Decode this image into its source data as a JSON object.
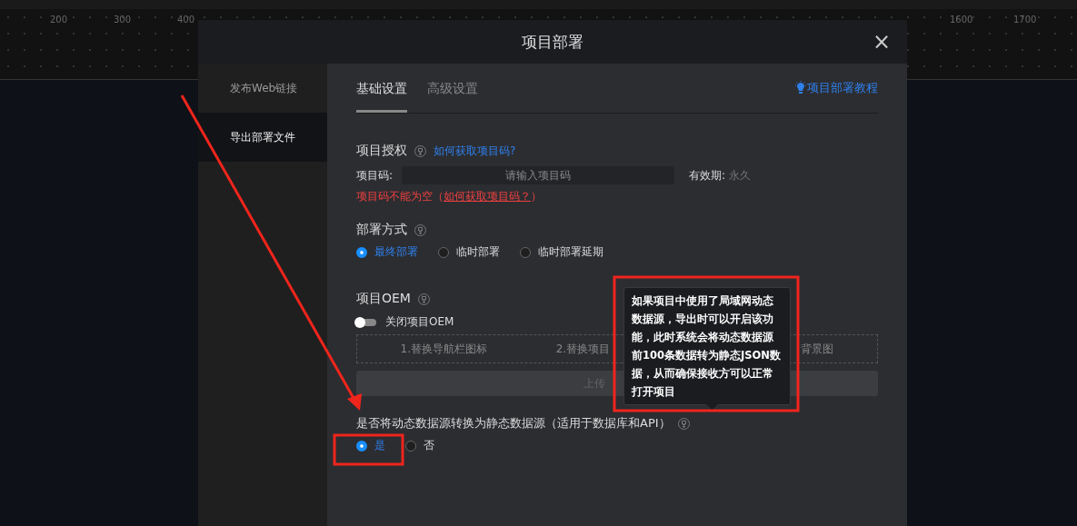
{
  "ruler": {
    "left_ticks": [
      "200",
      "300",
      "400"
    ],
    "right_ticks": [
      "1600",
      "1700"
    ]
  },
  "dialog": {
    "title": "项目部署",
    "close": "×"
  },
  "sidebar": {
    "items": [
      {
        "label": "发布Web链接",
        "selected": false
      },
      {
        "label": "导出部署文件",
        "selected": true
      }
    ]
  },
  "tabs": [
    {
      "label": "基础设置",
      "selected": true
    },
    {
      "label": "高级设置",
      "selected": false
    }
  ],
  "tutorial_link": "项目部署教程",
  "authorization": {
    "title": "项目授权",
    "help_link": "如何获取项目码?",
    "code_label": "项目码:",
    "code_placeholder": "请输入项目码",
    "validity_label": "有效期:",
    "validity_value": "永久",
    "error_before": "项目码不能为空（",
    "error_link": "如何获取项目码？",
    "error_after": "）"
  },
  "deploy_mode": {
    "title": "部署方式",
    "options": [
      {
        "label": "最终部署",
        "selected": true
      },
      {
        "label": "临时部署",
        "selected": false
      },
      {
        "label": "临时部署延期",
        "selected": false
      }
    ]
  },
  "oem": {
    "title": "项目OEM",
    "on": false,
    "toggle_label": "关闭项目OEM",
    "items": [
      "1.替换导航栏图标",
      "2.替换项目",
      "背景图"
    ],
    "upload_button": "上传",
    "upload_disabled": true
  },
  "convert": {
    "question": "是否将动态数据源转换为静态数据源（适用于数据库和API）",
    "options": [
      {
        "label": "是",
        "selected": true
      },
      {
        "label": "否",
        "selected": false
      }
    ]
  },
  "tooltip": "如果项目中使用了局域网动态数据源，导出时可以开启该功能，此时系统会将动态数据源前100条数据转为静态JSON数据，从而确保接收方可以正常打开项目"
}
